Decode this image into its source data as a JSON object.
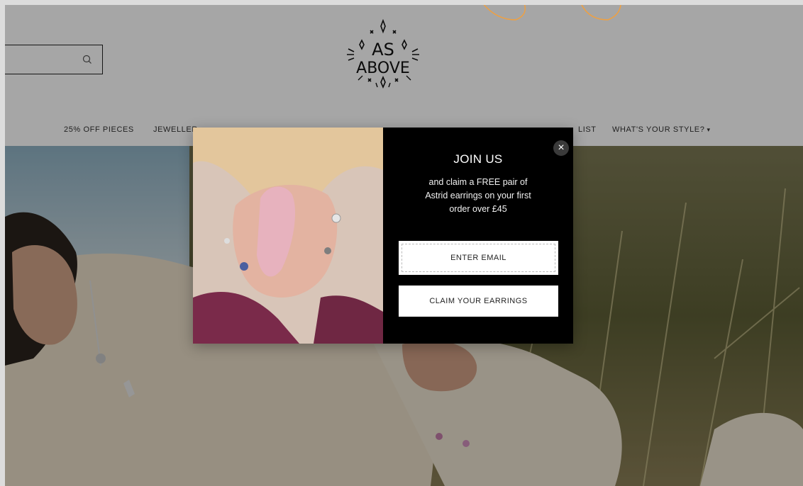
{
  "header": {
    "logo_text_line1": "AS",
    "logo_text_line2": "ABOVE",
    "search_placeholder": ""
  },
  "nav": {
    "items": [
      {
        "label": "25% OFF PIECES"
      },
      {
        "label": "JEWELLER"
      },
      {
        "label": "LIST"
      },
      {
        "label": "WHAT'S YOUR STYLE?"
      }
    ]
  },
  "popup": {
    "title": "JOIN US",
    "text_line1": "and claim a FREE pair of",
    "text_line2": "Astrid earrings on your first",
    "text_line3": "order over £45",
    "email_placeholder": "ENTER EMAIL",
    "submit_label": "CLAIM YOUR EARRINGS",
    "close_label": "×"
  },
  "colors": {
    "popup_bg": "#000000",
    "overlay": "rgba(0,0,0,0.35)",
    "accent_arc": "#f0a040"
  }
}
